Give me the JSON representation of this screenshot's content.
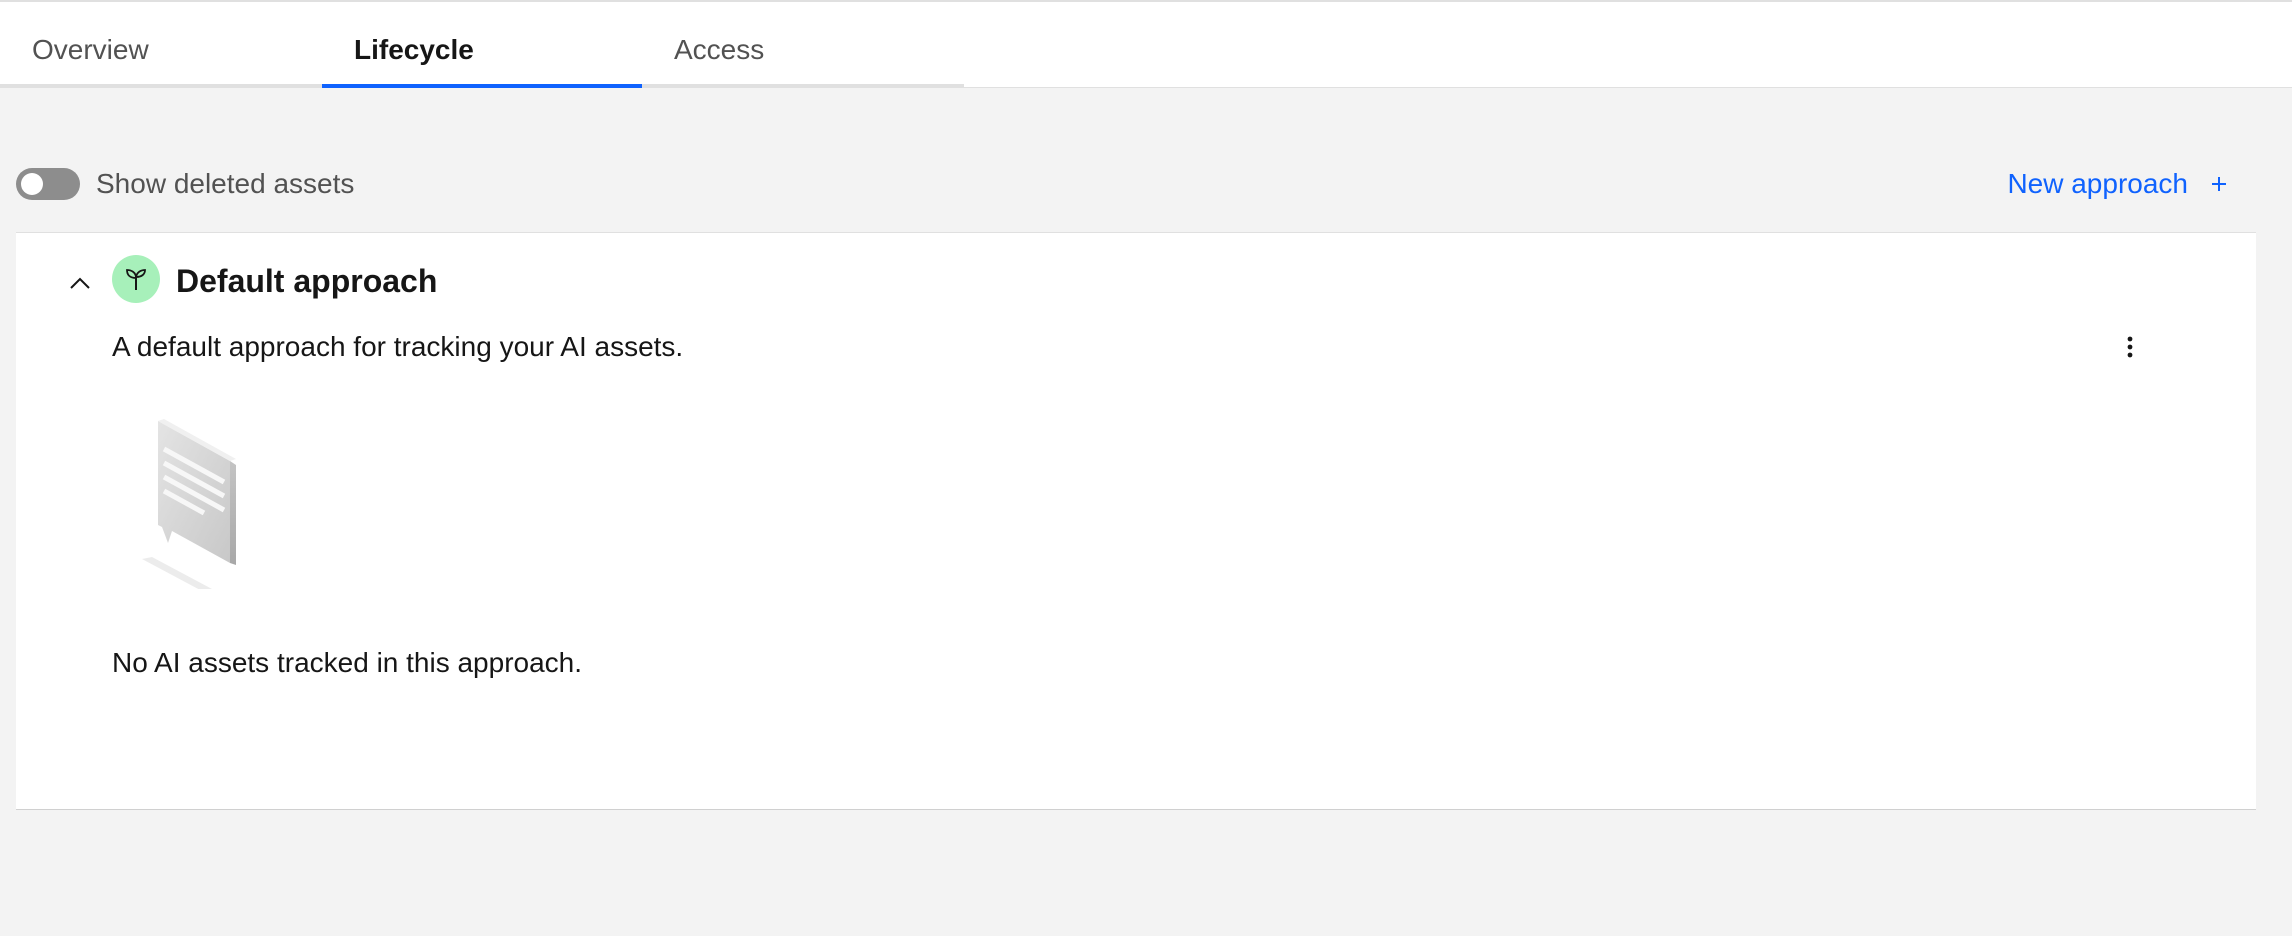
{
  "tabs": [
    {
      "label": "Overview",
      "active": false
    },
    {
      "label": "Lifecycle",
      "active": true
    },
    {
      "label": "Access",
      "active": false
    }
  ],
  "toolbar": {
    "toggle_label": "Show deleted assets",
    "toggle_on": false,
    "new_approach_label": "New approach",
    "new_approach_icon": "plus-icon"
  },
  "approach": {
    "title": "Default approach",
    "icon": "sprout-icon",
    "icon_bg": "#a7f0ba",
    "description": "A default approach for tracking your AI assets.",
    "expanded": true,
    "empty_message": "No AI assets tracked in this approach."
  },
  "colors": {
    "accent": "#0f62fe",
    "background": "#f3f3f3",
    "surface": "#ffffff"
  }
}
